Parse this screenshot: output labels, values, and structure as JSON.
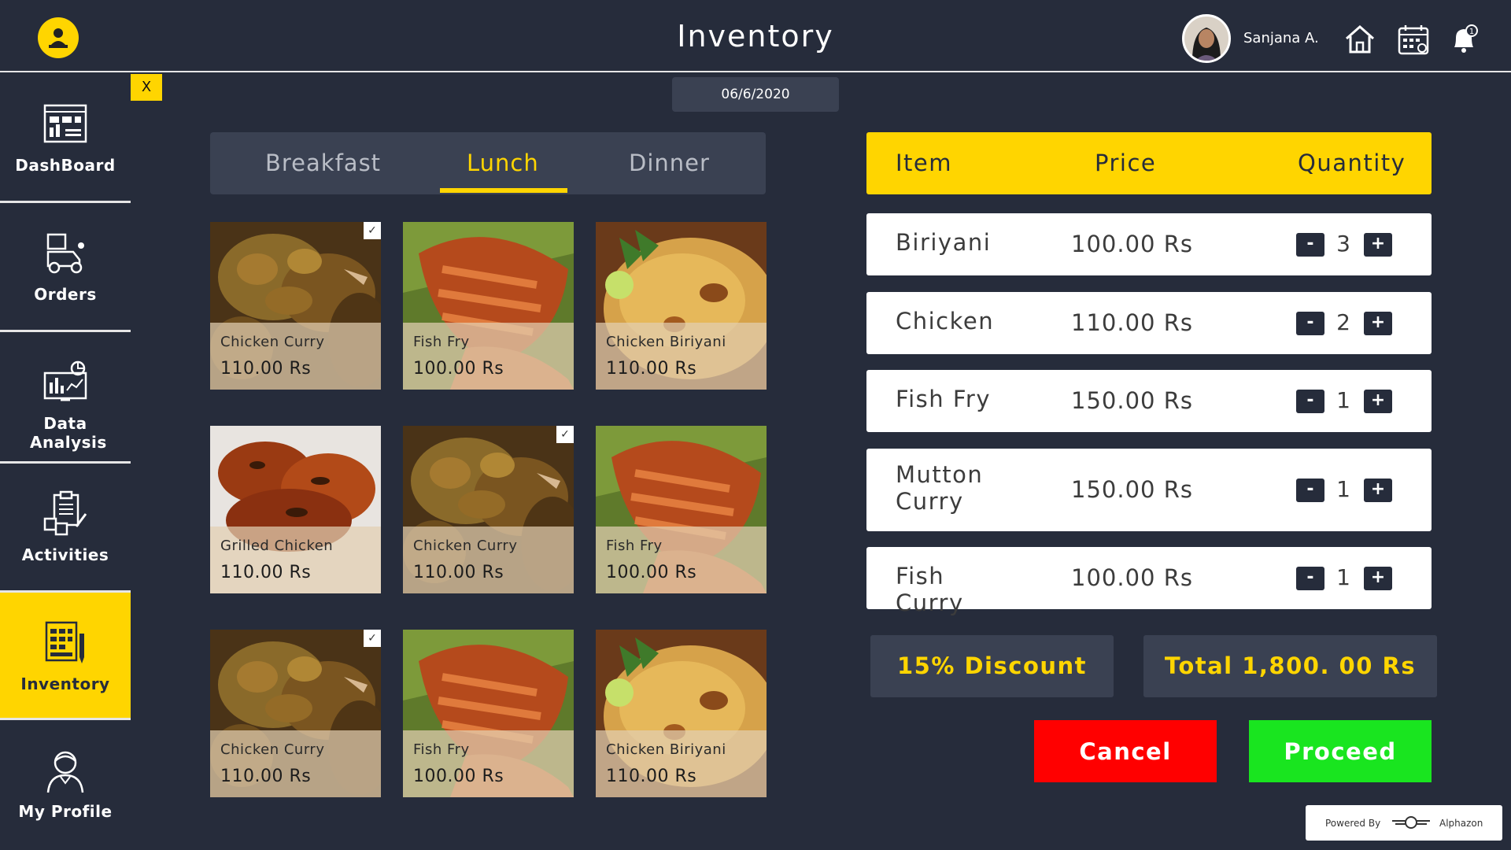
{
  "header": {
    "title": "Inventory",
    "user_name": "Sanjana A.",
    "icons": [
      "home-icon",
      "calendar-icon",
      "bell-icon"
    ]
  },
  "date": "06/6/2020",
  "close_label": "X",
  "sidebar": {
    "items": [
      {
        "label": "DashBoard",
        "icon": "dashboard-icon"
      },
      {
        "label": "Orders",
        "icon": "delivery-icon"
      },
      {
        "label": "Data Analysis",
        "icon": "analytics-icon"
      },
      {
        "label": "Activities",
        "icon": "activities-icon"
      },
      {
        "label": "Inventory",
        "icon": "inventory-icon",
        "active": true
      },
      {
        "label": "My Profile",
        "icon": "profile-icon"
      }
    ]
  },
  "tabs": [
    {
      "label": "Breakfast"
    },
    {
      "label": "Lunch",
      "active": true
    },
    {
      "label": "Dinner"
    }
  ],
  "menu_items": [
    {
      "name": "Chicken Curry",
      "price": "110.00 Rs",
      "checked": true
    },
    {
      "name": "Fish Fry",
      "price": "100.00 Rs",
      "checked": false
    },
    {
      "name": "Chicken Biriyani",
      "price": "110.00 Rs",
      "checked": false
    },
    {
      "name": "Grilled Chicken",
      "price": "110.00 Rs",
      "checked": false
    },
    {
      "name": "Chicken Curry",
      "price": "110.00 Rs",
      "checked": true
    },
    {
      "name": "Fish Fry",
      "price": "100.00 Rs",
      "checked": false
    },
    {
      "name": "Chicken Curry",
      "price": "110.00 Rs",
      "checked": true
    },
    {
      "name": "Fish Fry",
      "price": "100.00 Rs",
      "checked": false
    },
    {
      "name": "Chicken Biriyani",
      "price": "110.00 Rs",
      "checked": false
    }
  ],
  "order_table": {
    "headers": {
      "item": "Item",
      "price": "Price",
      "quantity": "Quantity"
    },
    "rows": [
      {
        "item": "Biriyani",
        "price": "100.00 Rs",
        "qty": "3"
      },
      {
        "item": "Chicken",
        "price": "110.00 Rs",
        "qty": "2"
      },
      {
        "item": "Fish Fry",
        "price": "150.00 Rs",
        "qty": "1"
      },
      {
        "item": "Mutton Curry",
        "price": "150.00 Rs",
        "qty": "1"
      },
      {
        "item": "Fish Curry",
        "price": "100.00 Rs",
        "qty": "1"
      }
    ],
    "minus_label": "-",
    "plus_label": "+"
  },
  "discount_label": "15% Discount",
  "total_label": "Total 1,800. 00 Rs",
  "buttons": {
    "cancel": "Cancel",
    "proceed": "Proceed"
  },
  "colors": {
    "accent": "#ffd500",
    "background": "#262c3b",
    "panel": "#3a4152",
    "cancel": "#ff0000",
    "proceed": "#19e51f"
  },
  "powered_by": {
    "label": "Powered By",
    "brand": "Alphazon"
  }
}
